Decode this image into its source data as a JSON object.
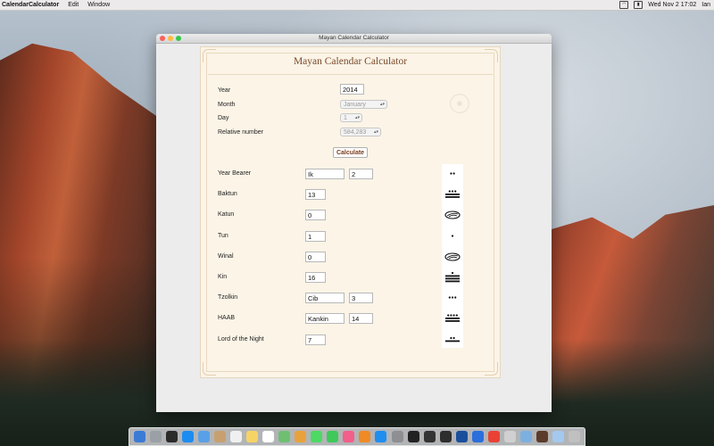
{
  "menubar": {
    "app_name": "CalendarCalculator",
    "menus": [
      "Edit",
      "Window"
    ],
    "status": {
      "clock": "Wed Nov 2  17:02",
      "user": "Ian",
      "battery_icon": "battery-icon",
      "wifi_icon": "wifi-icon"
    }
  },
  "window": {
    "title": "Mayan Calendar Calculator"
  },
  "panel": {
    "heading": "Mayan Calendar Calculator",
    "inputs": {
      "year_label": "Year",
      "year_value": "2014",
      "month_label": "Month",
      "month_value": "January",
      "day_label": "Day",
      "day_value": "1",
      "relative_label": "Relative number",
      "relative_value": "584,283",
      "calculate_label": "Calculate"
    },
    "results": [
      {
        "label": "Year Bearer",
        "value": "Ik",
        "value2": "2",
        "glyph": {
          "dots": 2,
          "bars": 0,
          "shell": false
        }
      },
      {
        "label": "Baktun",
        "value": "13",
        "value2": null,
        "glyph": {
          "dots": 3,
          "bars": 2,
          "shell": false
        }
      },
      {
        "label": "Katun",
        "value": "0",
        "value2": null,
        "glyph": {
          "dots": 0,
          "bars": 0,
          "shell": true
        }
      },
      {
        "label": "Tun",
        "value": "1",
        "value2": null,
        "glyph": {
          "dots": 1,
          "bars": 0,
          "shell": false
        }
      },
      {
        "label": "Winal",
        "value": "0",
        "value2": null,
        "glyph": {
          "dots": 0,
          "bars": 0,
          "shell": true
        }
      },
      {
        "label": "Kin",
        "value": "16",
        "value2": null,
        "glyph": {
          "dots": 1,
          "bars": 3,
          "shell": false
        }
      },
      {
        "label": "Tzolkin",
        "value": "Cib",
        "value2": "3",
        "glyph": {
          "dots": 3,
          "bars": 0,
          "shell": false
        }
      },
      {
        "label": "HAAB",
        "value": "Kankin",
        "value2": "14",
        "glyph": {
          "dots": 4,
          "bars": 2,
          "shell": false
        }
      },
      {
        "label": "Lord of the Night",
        "value": "7",
        "value2": null,
        "glyph": {
          "dots": 2,
          "bars": 1,
          "shell": false
        }
      }
    ]
  },
  "colors": {
    "parchment": "#fbf4e7",
    "title_brown": "#7a4a2a",
    "button_text": "#7a3a1a"
  },
  "dock": {
    "items": [
      "finder-icon",
      "launchpad-icon",
      "mission-control-icon",
      "safari-icon",
      "mail-icon",
      "contacts-icon",
      "calendar-icon",
      "notes-icon",
      "reminders-icon",
      "maps-icon",
      "photos-icon",
      "messages-icon",
      "facetime-icon",
      "itunes-icon",
      "ibooks-icon",
      "app-store-icon",
      "system-preferences-icon",
      "terminal-icon",
      "console-icon",
      "activity-icon",
      "network-icon",
      "vs-code-icon",
      "chrome-icon",
      "textedit-icon",
      "preview-icon",
      "calculator-app-icon",
      "folder-icon",
      "trash-icon"
    ]
  }
}
